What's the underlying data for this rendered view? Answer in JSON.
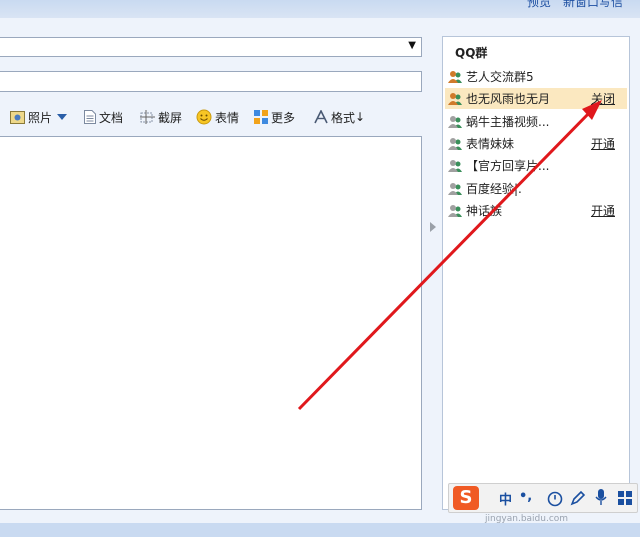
{
  "header": {
    "preview_link": "预览",
    "new_window_link": "新窗口写信"
  },
  "compose": {
    "select_arrow": "▼",
    "toolbar": {
      "photo": "照片",
      "document": "文档",
      "screenshot": "截屏",
      "emoticon": "表情",
      "more": "更多",
      "format": "格式",
      "format_arrow": "↓"
    }
  },
  "qq_groups": {
    "title": "QQ群",
    "groups": [
      {
        "name": "艺人交流群5",
        "action": "",
        "selected": false,
        "icon_color": "#d07a2a"
      },
      {
        "name": "也无风雨也无月",
        "action": "关闭",
        "selected": true,
        "icon_color": "#d07a2a"
      },
      {
        "name": "蜗牛主播视频...",
        "action": "",
        "selected": false,
        "icon_color": "#a0a0a0"
      },
      {
        "name": "表情妹妹",
        "action": "开通",
        "selected": false,
        "icon_color": "#a0a0a0"
      },
      {
        "name": "【官方回享片...",
        "action": "",
        "selected": false,
        "icon_color": "#a0a0a0"
      },
      {
        "name": "百度经验|.",
        "action": "",
        "selected": false,
        "icon_color": "#a0a0a0"
      },
      {
        "name": "神话族",
        "action": "开通",
        "selected": false,
        "icon_color": "#a0a0a0"
      }
    ]
  },
  "ime_toolbar": {
    "logo": "S",
    "mode": "中",
    "punct": "•,"
  },
  "watermark": "jingyan.baidu.com",
  "colors": {
    "annotation_arrow": "#e0181c",
    "selected_row": "#fbe8c0",
    "link": "#1e50a2"
  },
  "icons": [
    "photo-icon",
    "document-icon",
    "scissors-icon",
    "smiley-icon",
    "grid-icon",
    "format-a-icon",
    "qq-group-icon",
    "sogou-logo-icon",
    "microphone-icon"
  ]
}
